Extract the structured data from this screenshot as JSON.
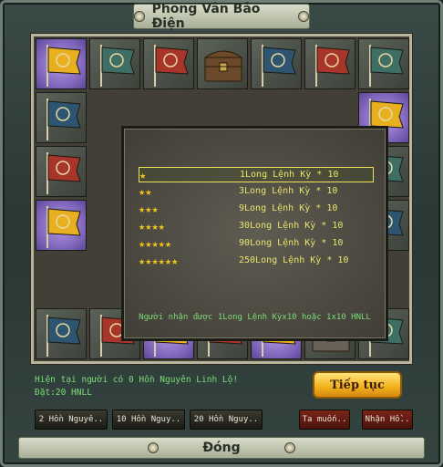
{
  "window": {
    "title": "Phong Vân Bảo Điện",
    "close_label": "Đóng"
  },
  "board": {
    "cells": [
      {
        "type": "flag",
        "color": "#e8b020",
        "hl": true
      },
      {
        "type": "flag",
        "color": "#3f6e64"
      },
      {
        "type": "flag",
        "color": "#a8352a"
      },
      {
        "type": "chest",
        "color": "#6a4a2a"
      },
      {
        "type": "flag",
        "color": "#2e5570"
      },
      {
        "type": "flag",
        "color": "#a8352a"
      },
      {
        "type": "flag",
        "color": "#3f6e64"
      },
      {
        "type": "flag",
        "color": "#2e5570"
      },
      {
        "type": "flag",
        "color": "#e8b020",
        "hl": true
      },
      {
        "type": "flag",
        "color": "#a8352a"
      },
      {
        "type": "flag",
        "color": "#3f6e64"
      },
      {
        "type": "flag",
        "color": "#e8b020",
        "hl": true
      },
      {
        "type": "flag",
        "color": "#2e5570"
      },
      {
        "type": "flag",
        "color": "#2e5570"
      },
      {
        "type": "flag",
        "color": "#a8352a"
      },
      {
        "type": "flag",
        "color": "#e8b020",
        "hl": true
      },
      {
        "type": "flag",
        "color": "#a8352a"
      },
      {
        "type": "flag",
        "color": "#e8b020",
        "hl": true
      },
      {
        "type": "chest",
        "color": "#6a6258"
      },
      {
        "type": "flag",
        "color": "#3f6e64"
      },
      {
        "type": "flag",
        "color": "#2e5570"
      },
      {
        "type": "flag",
        "color": "#3f6e64"
      }
    ]
  },
  "rewards": [
    {
      "stars": "★",
      "label": "1Long Lệnh Kỳ * 10",
      "selected": true
    },
    {
      "stars": "★★",
      "label": "3Long Lệnh Kỳ * 10"
    },
    {
      "stars": "★★★",
      "label": "9Long Lệnh Kỳ * 10"
    },
    {
      "stars": "★★★★",
      "label": "30Long Lệnh Kỳ * 10"
    },
    {
      "stars": "★★★★★",
      "label": "90Long Lệnh Kỳ * 10"
    },
    {
      "stars": "★★★★★★",
      "label": "250Long Lệnh Kỳ * 10"
    }
  ],
  "note": "Người nhận được 1Long Lệnh Kỳx10 hoặc 1x10 HNLL",
  "status": {
    "line1": "Hiện tại người có 0 Hồn Nguyên Linh Lộ!",
    "line2": "Đặt:20 HNLL"
  },
  "buttons": {
    "continue": "Tiếp tục",
    "opt1": "2 Hồn Nguyê..",
    "opt2": "10 Hồn Nguy..",
    "opt3": "20 Hồn Nguy..",
    "want": "Ta muốn..",
    "receive": "Nhận Hồ.."
  }
}
